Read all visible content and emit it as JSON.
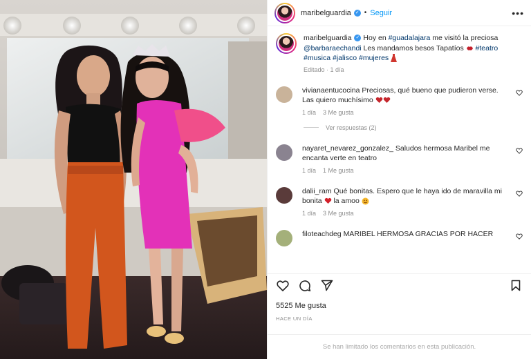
{
  "post": {
    "username": "maribelguardia",
    "dot": "•",
    "follow_label": "Seguir",
    "more_label": "•••"
  },
  "caption": {
    "username": "maribelguardia",
    "text_1": "Hoy en ",
    "hashtag_1": "#guadalajara",
    "text_2": " me visitó la preciosa ",
    "mention": "@barbaraechandi",
    "text_3": " Les mandamos besos Tapatíos ",
    "hashtag_teatro": "#teatro",
    "hashtag_musica": "#musica",
    "hashtag_jalisco": "#jalisco",
    "hashtag_mujeres": "#mujeres",
    "edited": "Editado",
    "time": "1 día"
  },
  "comments": [
    {
      "username": "vivianaentucocina",
      "text": "Preciosas, qué bueno que pudieron verse.",
      "text2": "Las quiero muchísimo",
      "time": "1 día",
      "likes": "3 Me gusta",
      "replies": "Ver respuestas (2)",
      "avatar_color": "#c9b39a"
    },
    {
      "username": "nayaret_nevarez_gonzalez_",
      "text": "Saludos hermosa Maribel me encanta verte en teatro",
      "time": "1 día",
      "likes": "1 Me gusta",
      "avatar_color": "#8a8390"
    },
    {
      "username": "dalii_ram",
      "text": "Qué bonitas. Espero que le haya ido de maravilla mi bonita",
      "text2": "la amoo",
      "time": "1 día",
      "likes": "3 Me gusta",
      "avatar_color": "#5a3b3a"
    },
    {
      "username": "filoteachdeg",
      "text": "MARIBEL HERMOSA GRACIAS POR HACER",
      "avatar_color": "#a4b07a"
    }
  ],
  "stats": {
    "likes": "5525 Me gusta",
    "date": "HACE UN DÍA"
  },
  "footer": {
    "limited": "Se han limitado los comentarios en esta publicación."
  },
  "colors": {
    "accent": "#0095f6",
    "verified": "#3897f0",
    "hashtag": "#00376b",
    "muted": "#8e8e8e"
  },
  "icons": [
    "verified-badge-icon",
    "more-options-icon",
    "heart-icon",
    "comment-icon",
    "share-icon",
    "bookmark-icon",
    "red-heart-emoji-icon",
    "kiss-mark-emoji-icon",
    "dress-emoji-icon",
    "smile-emoji-icon"
  ]
}
